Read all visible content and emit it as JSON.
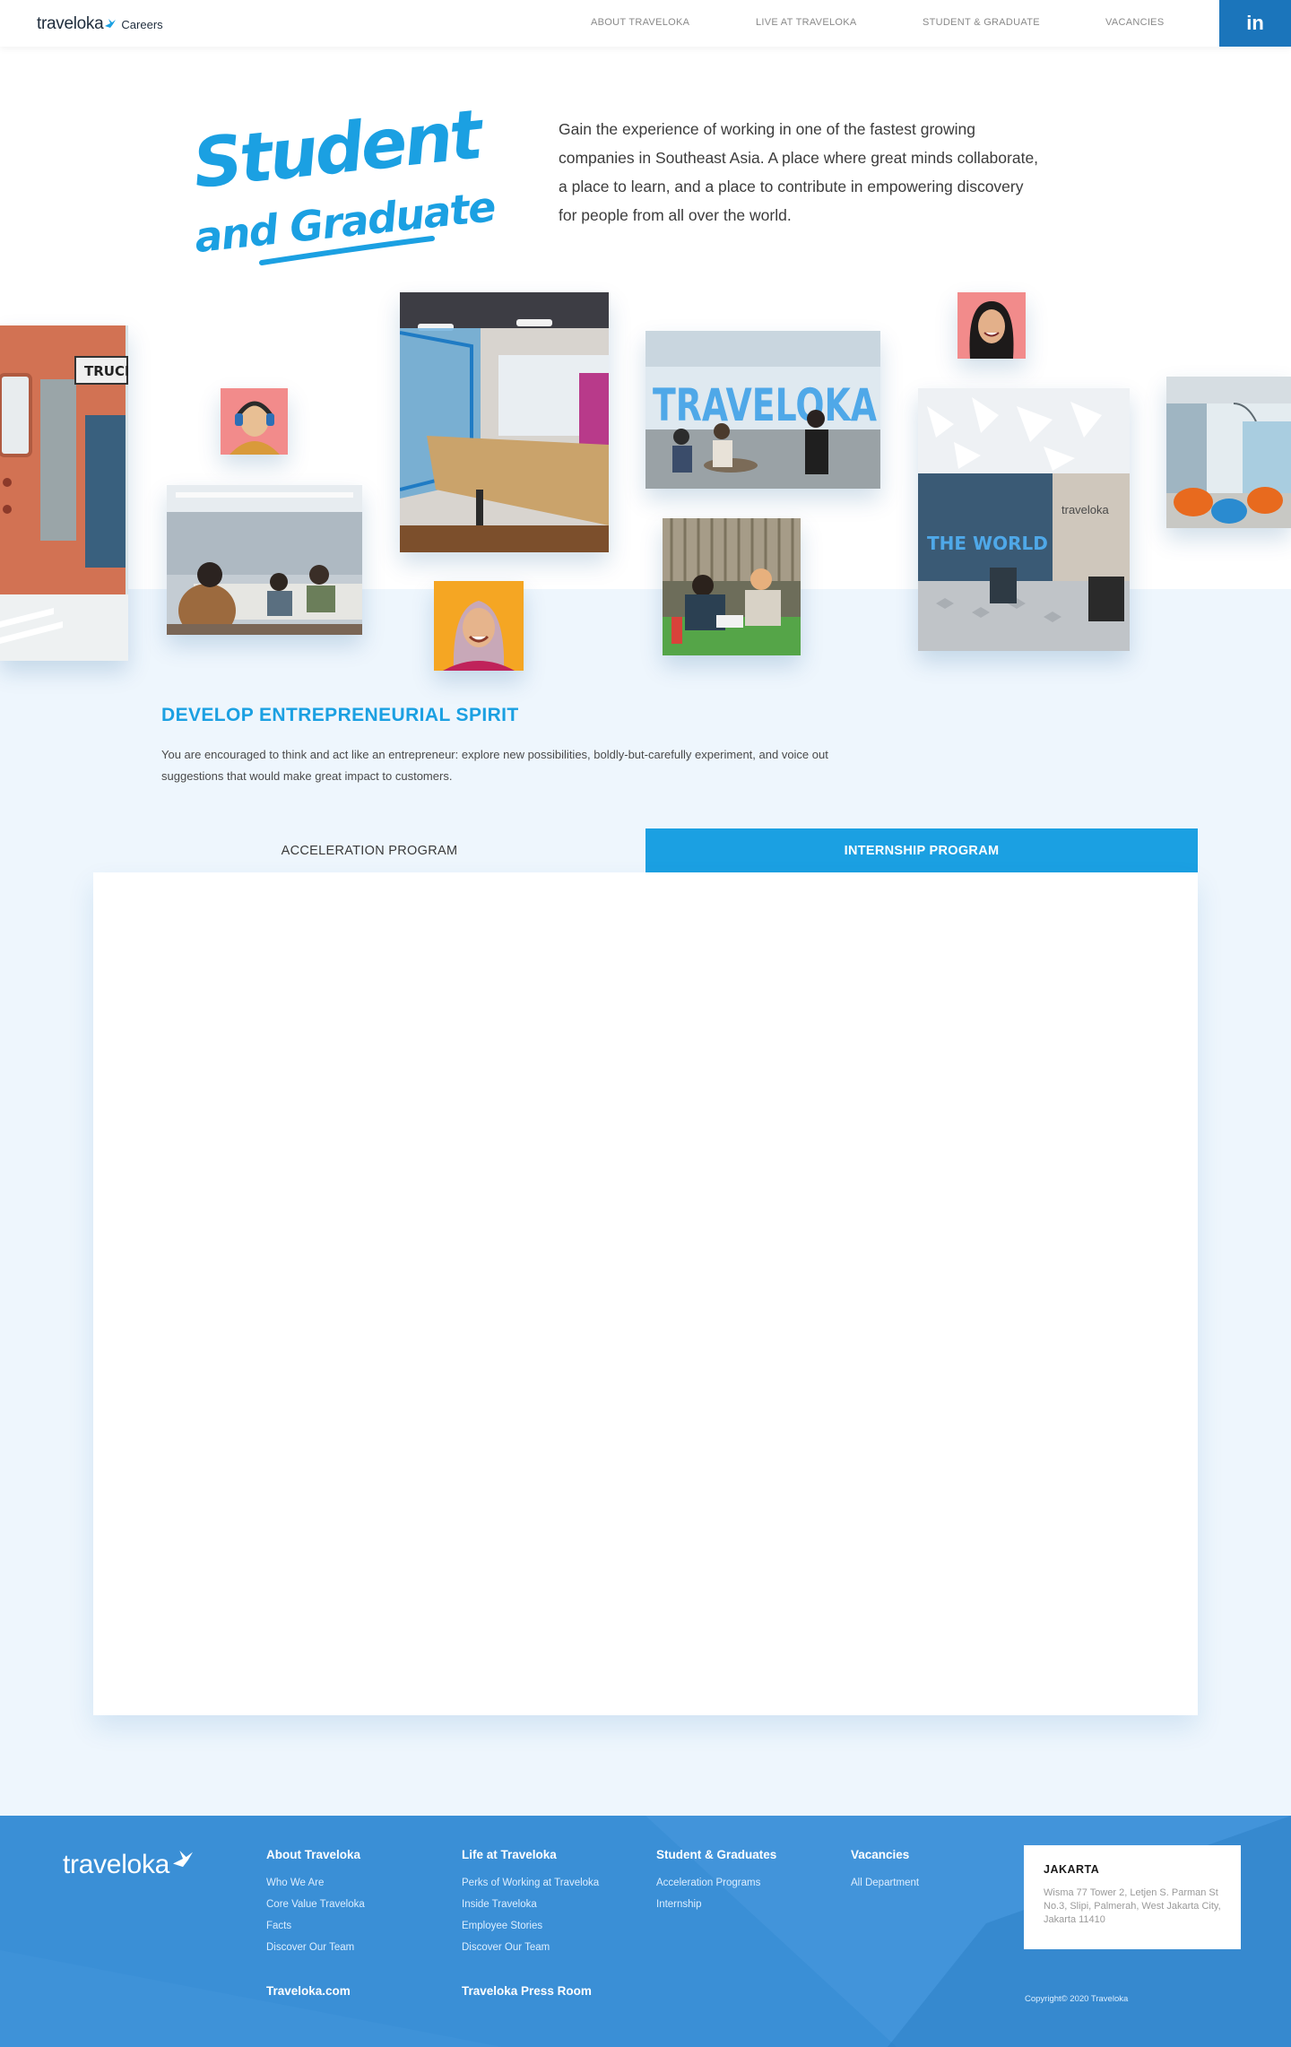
{
  "header": {
    "logo_word": "traveloka",
    "logo_suffix": "Careers",
    "nav": [
      "ABOUT TRAVELOKA",
      "LIVE AT TRAVELOKA",
      "STUDENT & GRADUATE",
      "VACANCIES"
    ],
    "linkedin_label": "in"
  },
  "hero": {
    "title_line1": "Student",
    "title_line2": "and Graduate",
    "description": "Gain the experience of working in one of the fastest growing companies in Southeast Asia. A place where great minds collaborate, a place to learn, and a place to contribute in empowering discovery for people from all over the world."
  },
  "photos": {
    "truck_sign": "TRUCK",
    "lobby_wall_text": "TRAVELOKA",
    "lobby_sign": "traveloka",
    "office_wall_text": "THE WORLD"
  },
  "feature": {
    "title": "DEVELOP ENTREPRENEURIAL SPIRIT",
    "description": "You are encouraged to think and act like an entrepreneur: explore new possibilities, boldly-but-carefully experiment, and voice out suggestions that would make great impact to customers."
  },
  "tabs": {
    "items": [
      "ACCELERATION PROGRAM",
      "INTERNSHIP PROGRAM"
    ],
    "active_index": 1
  },
  "footer": {
    "logo_word": "traveloka",
    "columns": [
      {
        "heading": "About Traveloka",
        "links": [
          "Who We Are",
          "Core Value Traveloka",
          "Facts",
          "Discover Our Team"
        ]
      },
      {
        "heading": "Life at Traveloka",
        "links": [
          "Perks of Working at Traveloka",
          "Inside Traveloka",
          "Employee Stories",
          "Discover Our Team"
        ]
      },
      {
        "heading": "Student & Graduates",
        "links": [
          "Acceleration Programs",
          "Internship"
        ]
      },
      {
        "heading": "Vacancies",
        "links": [
          "All Department"
        ]
      }
    ],
    "bottom_links": [
      "Traveloka.com",
      "Traveloka Press Room"
    ],
    "address": {
      "city": "JAKARTA",
      "text": "Wisma 77 Tower 2, Letjen S. Parman St No.3, Slipi, Palmerah, West Jakarta City, Jakarta 11410"
    },
    "copyright": "Copyright© 2020 Traveloka"
  },
  "colors": {
    "accent": "#1ba0e2",
    "footer": "#3a8fd6",
    "linkedin": "#1b75bb",
    "page_bg": "#eef6fd"
  }
}
